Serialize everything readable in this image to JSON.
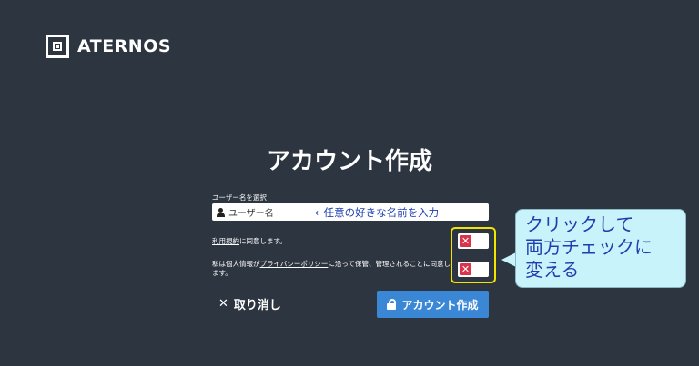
{
  "brand": {
    "name": "ATERNOS",
    "logo_icon": "aternos-logo-icon"
  },
  "page": {
    "title": "アカウント作成"
  },
  "username": {
    "label": "ユーザー名を選択",
    "placeholder": "ユーザー名",
    "hint": "←任意の好きな名前を入力"
  },
  "agreements": {
    "terms": {
      "link": "利用規約",
      "text": "に同意します。"
    },
    "privacy": {
      "prefix": "私は個人情報が",
      "link": "プライバシーポリシー",
      "suffix": "に沿って保管、管理されることに同意します。"
    },
    "toggle_state": "unchecked",
    "toggle_glyph": "✕"
  },
  "actions": {
    "cancel_glyph": "✕",
    "cancel_label": "取り消し",
    "create_label": "アカウント作成"
  },
  "annotation": {
    "lines": [
      "クリックして",
      "両方チェックに",
      "変える"
    ]
  },
  "colors": {
    "background": "#2c3540",
    "primary_button": "#3a87d6",
    "toggle_off": "#d9344a",
    "highlight": "#f2e600",
    "callout_bg": "#c9f3fa",
    "annotation_text": "#1f3fb0"
  }
}
